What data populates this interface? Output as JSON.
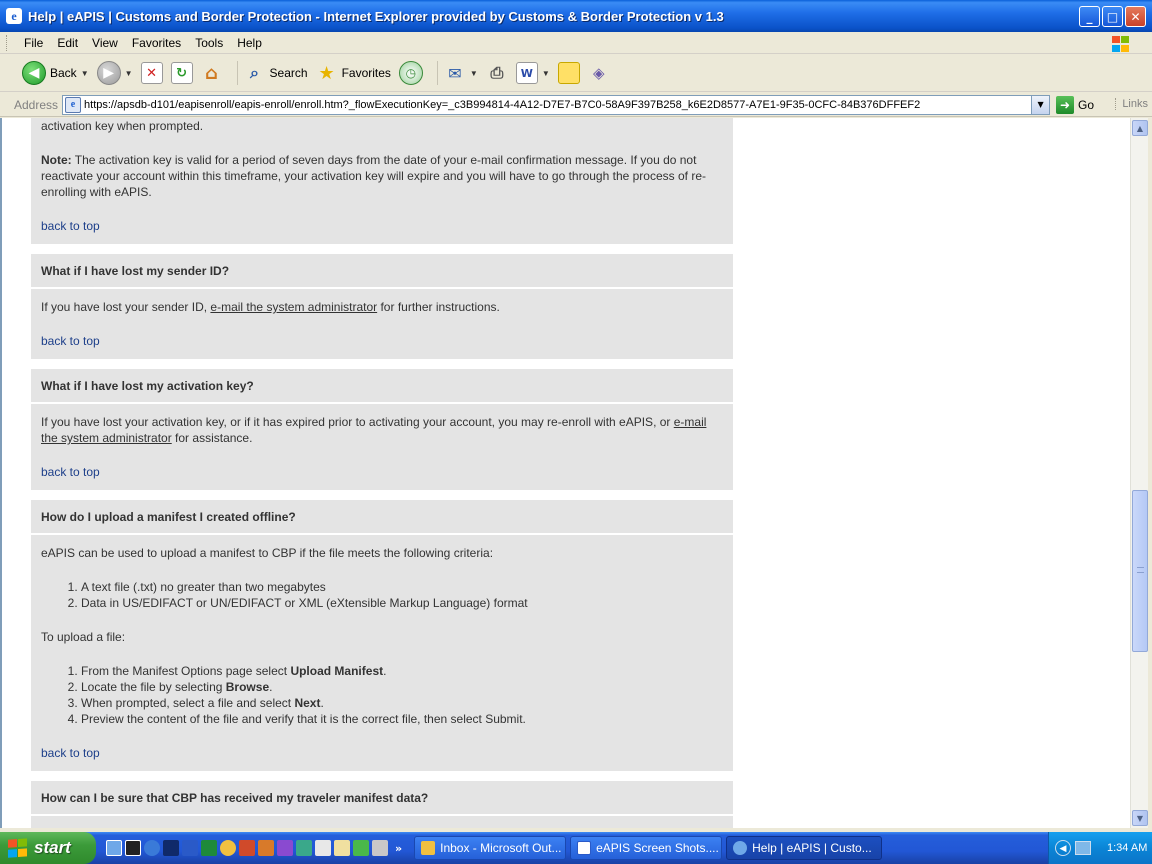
{
  "window": {
    "title": "Help | eAPIS | Customs and Border Protection - Internet Explorer provided by Customs & Border Protection v 1.3",
    "minimize_glyph": "_",
    "maximize_glyph": "□",
    "close_glyph": "✕"
  },
  "menu": {
    "file": "File",
    "edit": "Edit",
    "view": "View",
    "favorites": "Favorites",
    "tools": "Tools",
    "help": "Help"
  },
  "toolbar": {
    "back_label": "Back",
    "search_label": "Search",
    "favorites_label": "Favorites"
  },
  "address": {
    "label": "Address",
    "url": "https://apsdb-d101/eapisenroll/eapis-enroll/enroll.htm?_flowExecutionKey=_c3B994814-4A12-D7E7-B7C0-58A9F397B258_k6E2D8577-A7E1-9F35-0CFC-84B376DFFEF2",
    "go_label": "Go",
    "links_label": "Links"
  },
  "content": {
    "top_line": "activation key when prompted.",
    "note_label": "Note:",
    "note_text": " The activation key is valid for a period of seven days from the date of your e-mail confirmation message. If you do not reactivate your account within this timeframe, your activation key will expire and you will have to go through the process of re-enrolling with eAPIS.",
    "back_to_top": "back to top",
    "sender": {
      "heading": "What if I have lost my sender ID?",
      "before": "If you have lost your sender ID, ",
      "link": "e-mail the system administrator",
      "after": " for further instructions."
    },
    "activation": {
      "heading": "What if I have lost my activation key?",
      "before": "If you have lost your activation key, or if it has expired prior to activating your account, you may re-enroll with eAPIS, or ",
      "link": "e-mail the system administrator",
      "after": " for assistance."
    },
    "upload": {
      "heading": "How do I upload a manifest I created offline?",
      "intro": "eAPIS can be used to upload a manifest to CBP if the file meets the following criteria:",
      "criteria": [
        "A text file (.txt) no greater than two megabytes",
        "Data in US/EDIFACT or UN/EDIFACT or XML (eXtensible Markup Language) format"
      ],
      "steps_intro": "To upload a file:",
      "step1_before": "From the Manifest Options page select ",
      "step1_bold": "Upload Manifest",
      "step1_after": ".",
      "step2_before": "Locate the file by selecting ",
      "step2_bold": "Browse",
      "step2_after": ".",
      "step3_before": "When prompted, select a file and select ",
      "step3_bold": "Next",
      "step3_after": ".",
      "step4": "Preview the content of the file and verify that it is the correct file, then select Submit."
    },
    "received": {
      "heading": "How can I be sure that CBP has received my traveler manifest data?"
    }
  },
  "taskbar": {
    "start_label": "start",
    "tasks": [
      {
        "label": "Inbox - Microsoft Out..."
      },
      {
        "label": "eAPIS Screen Shots...."
      },
      {
        "label": "Help | eAPIS | Custo..."
      }
    ],
    "clock": "1:34 AM"
  },
  "colors": {
    "section_bg": "#e4e4e4",
    "back_to_top_link": "#1d3f8a",
    "title_bar": "#0a52c8",
    "taskbar": "#245edb",
    "start_button": "#3c9b3a"
  }
}
